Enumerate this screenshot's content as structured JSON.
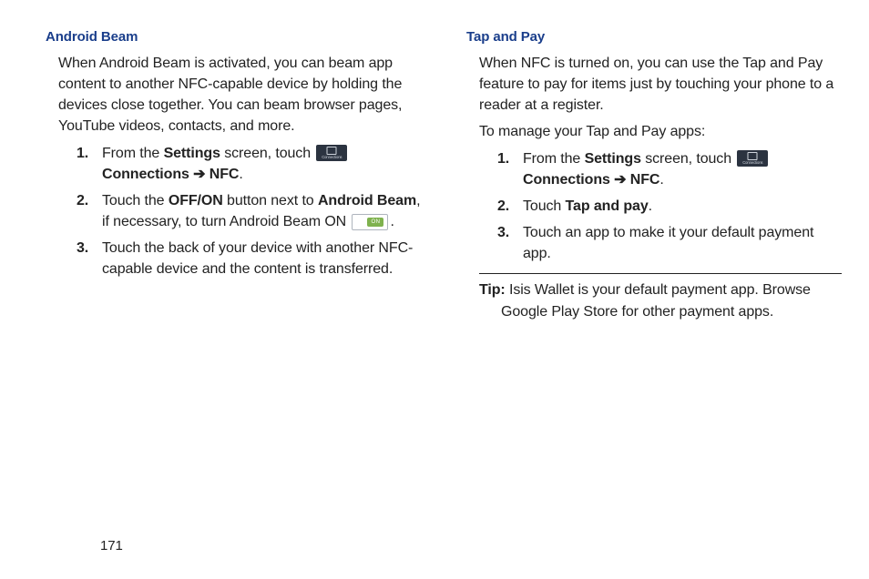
{
  "left": {
    "title": "Android Beam",
    "intro": "When Android Beam is activated, you can beam app content to another NFC-capable device by holding the devices close together. You can beam browser pages, YouTube videos, contacts, and more.",
    "steps": [
      {
        "num": "1.",
        "pre": "From the ",
        "b1": "Settings",
        "mid": " screen, touch ",
        "b2": "Connections",
        "arrow": " ➔ ",
        "b3": "NFC",
        "post": "."
      },
      {
        "num": "2.",
        "pre": "Touch the ",
        "b1": "OFF/ON",
        "mid": " button next to ",
        "b2": "Android Beam",
        "post1": ", if necessary, to turn Android Beam ON ",
        "post2": "."
      },
      {
        "num": "3.",
        "text": "Touch the back of your device with another NFC-capable device and the content is transferred."
      }
    ]
  },
  "right": {
    "title": "Tap and Pay",
    "intro": "When NFC is turned on, you can use the Tap and Pay feature to pay for items just by touching your phone to a reader at a register.",
    "sub": "To manage your Tap and Pay apps:",
    "steps": [
      {
        "num": "1.",
        "pre": "From the ",
        "b1": "Settings",
        "mid": " screen, touch ",
        "b2": "Connections",
        "arrow": " ➔ ",
        "b3": "NFC",
        "post": "."
      },
      {
        "num": "2.",
        "pre": "Touch ",
        "b1": "Tap and pay",
        "post": "."
      },
      {
        "num": "3.",
        "text": "Touch an app to make it your default payment app."
      }
    ],
    "tip_label": "Tip:",
    "tip_text": " Isis Wallet is your default payment app. Browse Google Play Store for other payment apps."
  },
  "switch_label": "ON",
  "page_number": "171"
}
